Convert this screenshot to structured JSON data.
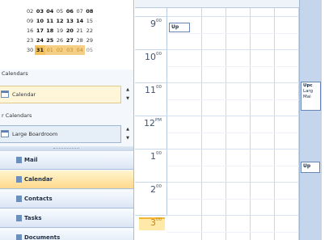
{
  "mini_calendar": {
    "rows": [
      [
        {
          "t": "02",
          "s": ""
        },
        {
          "t": "03",
          "s": "b"
        },
        {
          "t": "04",
          "s": "b"
        },
        {
          "t": "05",
          "s": ""
        },
        {
          "t": "06",
          "s": "b"
        },
        {
          "t": "07",
          "s": ""
        },
        {
          "t": "08",
          "s": "b"
        }
      ],
      [
        {
          "t": "09",
          "s": ""
        },
        {
          "t": "10",
          "s": "b"
        },
        {
          "t": "11",
          "s": "b"
        },
        {
          "t": "12",
          "s": "b"
        },
        {
          "t": "13",
          "s": "b"
        },
        {
          "t": "14",
          "s": "b"
        },
        {
          "t": "15",
          "s": ""
        }
      ],
      [
        {
          "t": "16",
          "s": ""
        },
        {
          "t": "17",
          "s": "b"
        },
        {
          "t": "18",
          "s": "b"
        },
        {
          "t": "19",
          "s": ""
        },
        {
          "t": "20",
          "s": "b"
        },
        {
          "t": "21",
          "s": ""
        },
        {
          "t": "22",
          "s": ""
        }
      ],
      [
        {
          "t": "23",
          "s": ""
        },
        {
          "t": "24",
          "s": "b"
        },
        {
          "t": "25",
          "s": "b"
        },
        {
          "t": "26",
          "s": ""
        },
        {
          "t": "27",
          "s": "b"
        },
        {
          "t": "28",
          "s": ""
        },
        {
          "t": "29",
          "s": ""
        }
      ],
      [
        {
          "t": "30",
          "s": ""
        },
        {
          "t": "31",
          "s": "sel"
        },
        {
          "t": "01",
          "s": "hl"
        },
        {
          "t": "02",
          "s": "hl"
        },
        {
          "t": "03",
          "s": "hl"
        },
        {
          "t": "04",
          "s": "hl"
        },
        {
          "t": "05",
          "s": "dim"
        }
      ]
    ]
  },
  "sections": {
    "calendars": "Calendars",
    "other_calendars": "r Calendars"
  },
  "calendar_items": {
    "calendar": "Calendar",
    "boardroom": "Large Boardroom"
  },
  "nav_buttons": [
    {
      "label": "Mail",
      "active": false
    },
    {
      "label": "Calendar",
      "active": true
    },
    {
      "label": "Contacts",
      "active": false
    },
    {
      "label": "Tasks",
      "active": false
    },
    {
      "label": "Documents",
      "active": false
    }
  ],
  "time_slots": [
    {
      "h": "9",
      "m": "00",
      "cur": false
    },
    {
      "h": "10",
      "m": "00",
      "cur": false
    },
    {
      "h": "11",
      "m": "00",
      "cur": false
    },
    {
      "h": "12",
      "m": "PM",
      "cur": false
    },
    {
      "h": "1",
      "m": "00",
      "cur": false
    },
    {
      "h": "2",
      "m": "00",
      "cur": false
    },
    {
      "h": "3",
      "m": "00",
      "cur": true
    }
  ],
  "appointments": {
    "a1": "Up",
    "a2_line1": "Upc",
    "a2_line2": "Larg",
    "a2_line3": "Mai",
    "a3": "Up"
  }
}
